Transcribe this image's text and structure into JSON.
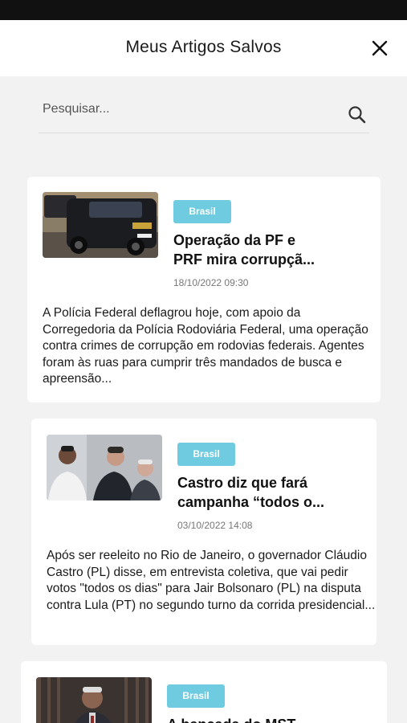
{
  "header": {
    "title": "Meus Artigos Salvos"
  },
  "search": {
    "placeholder": "Pesquisar..."
  },
  "articles": [
    {
      "category": "Brasil",
      "title": "Operação da PF e\nPRF mira corrupçã...",
      "date": "18/10/2022 09:30",
      "excerpt": "A Polícia Federal deflagrou hoje, com apoio da Corregedoria da Polícia Rodoviária Federal, uma operação contra crimes de corrupção em rodovias federais. Agentes foram às ruas para cumprir três mandados de busca e apreensão..."
    },
    {
      "category": "Brasil",
      "title": "Castro diz que fará\ncampanha “todos o...",
      "date": "03/10/2022 14:08",
      "excerpt": "Após ser reeleito no Rio de Janeiro, o governador Cláudio Castro (PL) disse, em entrevista coletiva, que vai pedir votos \"todos os dias\" para Jair Bolsonaro (PL) na disputa contra Lula (PT) no segundo turno da corrida presidencial..."
    },
    {
      "category": "Brasil",
      "title": "A bancada do MST"
    }
  ],
  "colors": {
    "badge": "#6ecbe0",
    "background": "#f2f2f2"
  },
  "icons": {
    "close": "close-icon",
    "search": "search-icon"
  }
}
